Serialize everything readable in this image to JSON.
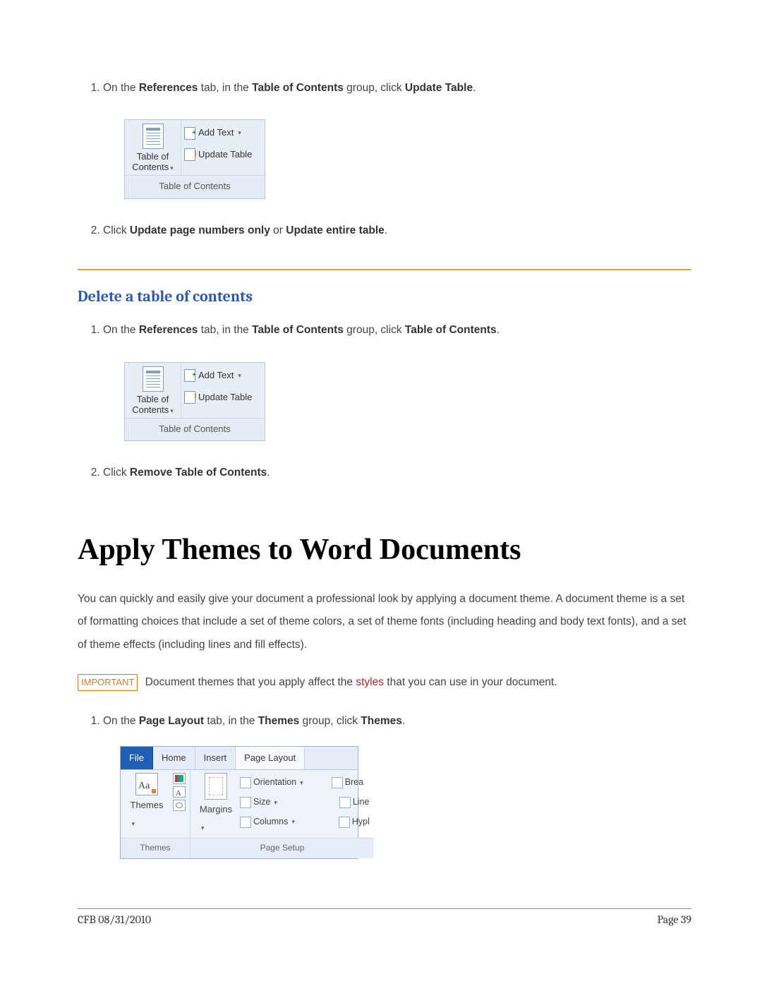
{
  "steps1": {
    "item1_pre": "On the ",
    "item1_b1": "References",
    "item1_mid1": " tab, in the ",
    "item1_b2": "Table of Contents",
    "item1_mid2": " group, click ",
    "item1_b3": "Update Table",
    "item1_post": ".",
    "item2_pre": "Click ",
    "item2_b1": "Update page numbers only",
    "item2_mid": " or ",
    "item2_b2": "Update entire table",
    "item2_post": "."
  },
  "ribbon": {
    "toc_label_l1": "Table of",
    "toc_label_l2": "Contents",
    "add_text": "Add Text",
    "update_table": "Update Table",
    "footer": "Table of Contents"
  },
  "subhead": "Delete a table of contents",
  "steps2": {
    "item1_pre": "On the ",
    "item1_b1": "References",
    "item1_mid1": " tab, in the ",
    "item1_b2": "Table of Contents",
    "item1_mid2": " group, click ",
    "item1_b3": "Table of Contents",
    "item1_post": ".",
    "item2_pre": "Click ",
    "item2_b1": "Remove Table of Contents",
    "item2_post": "."
  },
  "title": "Apply Themes to Word Documents",
  "para1": "You can quickly and easily give your document a professional look by applying a document theme. A document theme is a set of formatting choices that include a set of theme colors, a set of theme fonts (including heading and body text fonts), and a set of theme effects (including lines and fill effects).",
  "important_label": "IMPORTANT",
  "important_pre": "  Document themes that you apply affect the ",
  "important_link": "styles",
  "important_post": " that you can use in your document.",
  "steps3": {
    "item1_pre": "On the ",
    "item1_b1": "Page Layout",
    "item1_mid1": " tab, in the ",
    "item1_b2": "Themes",
    "item1_mid2": " group, click ",
    "item1_b3": "Themes",
    "item1_post": "."
  },
  "word": {
    "tabs": {
      "file": "File",
      "home": "Home",
      "insert": "Insert",
      "page_layout": "Page Layout"
    },
    "themes_label": "Themes",
    "margins_label": "Margins",
    "orientation": "Orientation",
    "size": "Size",
    "columns": "Columns",
    "breaks": "Brea",
    "line": "Line",
    "hyph": "Hypl",
    "grp_themes": "Themes",
    "grp_ps": "Page Setup"
  },
  "footer": {
    "left": "CFB 08/31/2010",
    "right": "Page 39"
  }
}
